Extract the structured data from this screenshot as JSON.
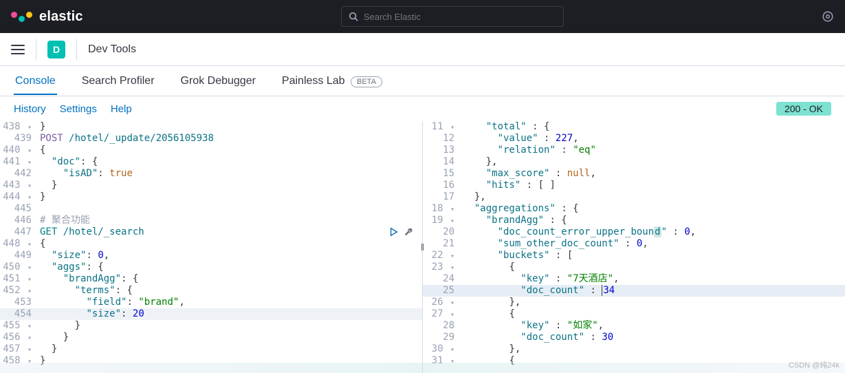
{
  "header": {
    "brand": "elastic",
    "search_placeholder": "Search Elastic"
  },
  "subheader": {
    "badge_letter": "D",
    "app_title": "Dev Tools"
  },
  "tabs": {
    "console": "Console",
    "profiler": "Search Profiler",
    "grok": "Grok Debugger",
    "painless": "Painless Lab",
    "beta": "BETA"
  },
  "toolbar": {
    "history": "History",
    "settings": "Settings",
    "help": "Help",
    "status": "200 - OK"
  },
  "editor_left": {
    "lines": [
      {
        "n": "438",
        "fold": "▾",
        "html": "<span class='punct'>}</span>"
      },
      {
        "n": "439",
        "fold": "",
        "html": "<span class='method-post'>POST</span> <span class='path'>/hotel/_update/2056105938</span>"
      },
      {
        "n": "440",
        "fold": "▾",
        "html": "<span class='punct'>{</span>"
      },
      {
        "n": "441",
        "fold": "▾",
        "html": "  <span class='key'>\"doc\"</span><span class='punct'>: {</span>"
      },
      {
        "n": "442",
        "fold": "",
        "html": "    <span class='key'>\"isAD\"</span><span class='punct'>:</span> <span class='bool'>true</span>"
      },
      {
        "n": "443",
        "fold": "▾",
        "html": "  <span class='punct'>}</span>"
      },
      {
        "n": "444",
        "fold": "▾",
        "html": "<span class='punct'>}</span>"
      },
      {
        "n": "445",
        "fold": "",
        "html": ""
      },
      {
        "n": "446",
        "fold": "",
        "html": "<span class='comment'># 聚合功能</span>"
      },
      {
        "n": "447",
        "fold": "",
        "html": "<span class='method-get'>GET</span> <span class='path'>/hotel/_search</span>"
      },
      {
        "n": "448",
        "fold": "▾",
        "html": "<span class='punct'>{</span>"
      },
      {
        "n": "449",
        "fold": "",
        "html": "  <span class='key'>\"size\"</span><span class='punct'>:</span> <span class='num'>0</span><span class='punct'>,</span>"
      },
      {
        "n": "450",
        "fold": "▾",
        "html": "  <span class='key'>\"aggs\"</span><span class='punct'>: {</span>"
      },
      {
        "n": "451",
        "fold": "▾",
        "html": "    <span class='key'>\"brandAgg\"</span><span class='punct'>: {</span>"
      },
      {
        "n": "452",
        "fold": "▾",
        "html": "      <span class='key'>\"terms\"</span><span class='punct'>: {</span>"
      },
      {
        "n": "453",
        "fold": "",
        "html": "        <span class='key'>\"field\"</span><span class='punct'>:</span> <span class='str'>\"brand\"</span><span class='punct'>,</span>"
      },
      {
        "n": "454",
        "fold": "",
        "html": "        <span class='key'>\"size\"</span><span class='punct'>:</span> <span class='num'>20</span>"
      },
      {
        "n": "455",
        "fold": "▾",
        "html": "      <span class='punct'>}</span>"
      },
      {
        "n": "456",
        "fold": "▾",
        "html": "    <span class='punct'>}</span>"
      },
      {
        "n": "457",
        "fold": "▾",
        "html": "  <span class='punct'>}</span>"
      },
      {
        "n": "458",
        "fold": "▾",
        "html": "<span class='punct'>}</span>"
      }
    ],
    "highlight_index": 16,
    "run_row_index": 9
  },
  "editor_right": {
    "lines": [
      {
        "n": "11",
        "fold": "▾",
        "html": "    <span class='key'>\"total\"</span> <span class='punct'>: {</span>"
      },
      {
        "n": "12",
        "fold": "",
        "html": "      <span class='key'>\"value\"</span> <span class='punct'>:</span> <span class='num'>227</span><span class='punct'>,</span>"
      },
      {
        "n": "13",
        "fold": "",
        "html": "      <span class='key'>\"relation\"</span> <span class='punct'>:</span> <span class='str'>\"eq\"</span>"
      },
      {
        "n": "14",
        "fold": "",
        "html": "    <span class='punct'>},</span>"
      },
      {
        "n": "15",
        "fold": "",
        "html": "    <span class='key'>\"max_score\"</span> <span class='punct'>:</span> <span class='null'>null</span><span class='punct'>,</span>"
      },
      {
        "n": "16",
        "fold": "",
        "html": "    <span class='key'>\"hits\"</span> <span class='punct'>: [ ]</span>"
      },
      {
        "n": "17",
        "fold": "",
        "html": "  <span class='punct'>},</span>"
      },
      {
        "n": "18",
        "fold": "▾",
        "html": "  <span class='key'>\"aggregations\"</span> <span class='punct'>: {</span>"
      },
      {
        "n": "19",
        "fold": "▾",
        "html": "    <span class='key'>\"brandAgg\"</span> <span class='punct'>: {</span>"
      },
      {
        "n": "20",
        "fold": "",
        "html": "      <span class='key'>\"doc_count_error_upper_boun<span class='sel-box'>d</span>\"</span> <span class='punct'>:</span> <span class='num'>0</span><span class='punct'>,</span>"
      },
      {
        "n": "21",
        "fold": "",
        "html": "      <span class='key'>\"sum_other_doc_count\"</span> <span class='punct'>:</span> <span class='num'>0</span><span class='punct'>,</span>"
      },
      {
        "n": "22",
        "fold": "▾",
        "html": "      <span class='key'>\"buckets\"</span> <span class='punct'>: [</span>"
      },
      {
        "n": "23",
        "fold": "▾",
        "html": "        <span class='punct'>{</span>"
      },
      {
        "n": "24",
        "fold": "",
        "html": "          <span class='key'>\"key\"</span> <span class='punct'>:</span> <span class='str'>\"7天酒店\"</span><span class='punct'>,</span>"
      },
      {
        "n": "25",
        "fold": "",
        "html": "          <span class='key'>\"doc_count\"</span> <span class='punct'>:</span> <span class='num'><span class='cursor-mark'>3</span>4</span>"
      },
      {
        "n": "26",
        "fold": "▾",
        "html": "        <span class='punct'>},</span>"
      },
      {
        "n": "27",
        "fold": "▾",
        "html": "        <span class='punct'>{</span>"
      },
      {
        "n": "28",
        "fold": "",
        "html": "          <span class='key'>\"key\"</span> <span class='punct'>:</span> <span class='str'>\"如家\"</span><span class='punct'>,</span>"
      },
      {
        "n": "29",
        "fold": "",
        "html": "          <span class='key'>\"doc_count\"</span> <span class='punct'>:</span> <span class='num'>30</span>"
      },
      {
        "n": "30",
        "fold": "▾",
        "html": "        <span class='punct'>},</span>"
      },
      {
        "n": "31",
        "fold": "▾",
        "html": "        <span class='punct'>{</span>"
      }
    ],
    "highlight_index": 14
  },
  "watermark": "CSDN @纯24k"
}
